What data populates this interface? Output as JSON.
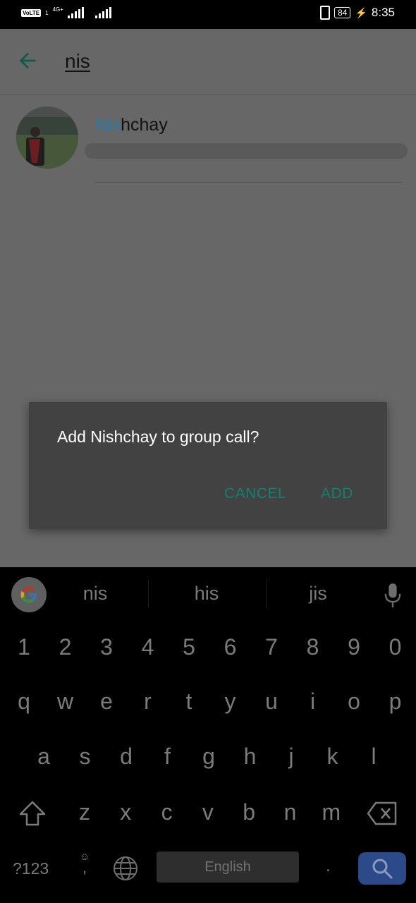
{
  "status_bar": {
    "volte_label": "VoLTE",
    "sim_slot": "1",
    "network_type": "4G+",
    "battery_level": "84",
    "time": "8:35"
  },
  "search": {
    "query": "nis"
  },
  "results": [
    {
      "name_highlight": "Nis",
      "name_rest": "hchay",
      "subtitle": "[redacted]"
    }
  ],
  "dialog": {
    "message": "Add Nishchay to group call?",
    "cancel_label": "CANCEL",
    "confirm_label": "ADD",
    "accent_color": "#14806f"
  },
  "keyboard": {
    "suggestions": [
      "nis",
      "his",
      "jis"
    ],
    "number_row": [
      "1",
      "2",
      "3",
      "4",
      "5",
      "6",
      "7",
      "8",
      "9",
      "0"
    ],
    "row1": [
      "q",
      "w",
      "e",
      "r",
      "t",
      "y",
      "u",
      "i",
      "o",
      "p"
    ],
    "row2": [
      "a",
      "s",
      "d",
      "f",
      "g",
      "h",
      "j",
      "k",
      "l"
    ],
    "row3": [
      "z",
      "x",
      "c",
      "v",
      "b",
      "n",
      "m"
    ],
    "symbols_label": "?123",
    "comma_label": ",",
    "space_label": "English",
    "period_label": ".",
    "action_color": "#2c4a8a"
  }
}
